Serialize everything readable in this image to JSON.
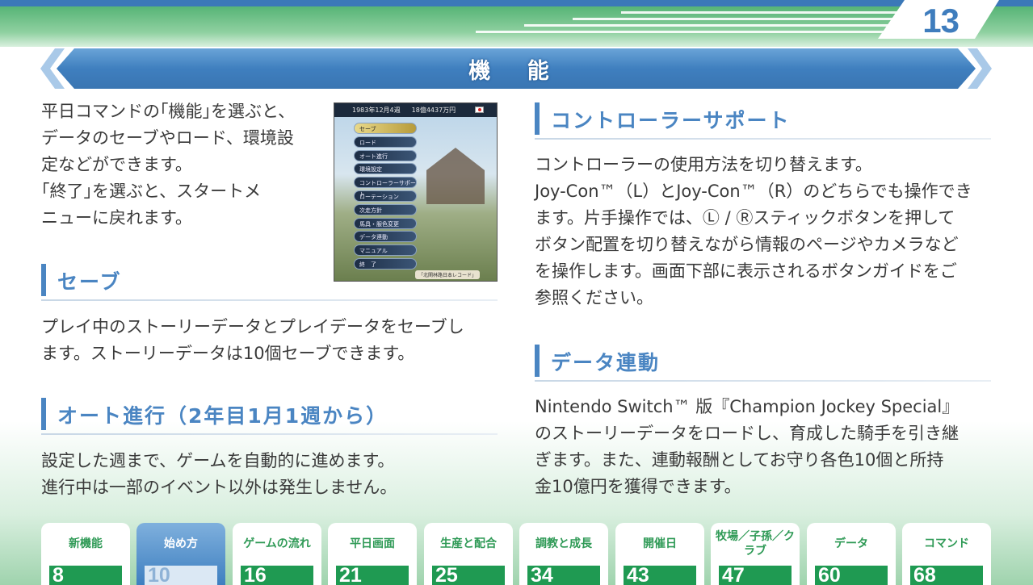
{
  "page_number": "13",
  "title": "機 能",
  "intro": {
    "lines": [
      "平日コマンドの｢機能｣を選ぶと、",
      "データのセーブやロード、環境設",
      "定などができます。",
      "｢終了｣を選ぶと、スタートメ",
      "ニューに戻れます。"
    ]
  },
  "screenshot": {
    "date": "1983年12月4週",
    "money": "18億4437万円",
    "menu": [
      "セーブ",
      "ロード",
      "オート進行",
      "環境設定",
      "コントローラーサポート",
      "ローテーション",
      "次走方針",
      "馬具・服色変更",
      "データ連動",
      "マニュアル",
      "終　了"
    ],
    "caption": "「北関林路日本レコード」"
  },
  "sections": {
    "save": {
      "heading": "セーブ",
      "lines": [
        "プレイ中のストーリーデータとプレイデータをセーブし",
        "ます。ストーリーデータは10個セーブできます。"
      ]
    },
    "auto": {
      "heading": "オート進行（2年目1月1週から）",
      "lines": [
        "設定した週まで、ゲームを自動的に進めます。",
        "進行中は一部のイベント以外は発生しません。"
      ]
    },
    "controller": {
      "heading": "コントローラーサポート",
      "lines": [
        "コントローラーの使用方法を切り替えます。",
        "Joy-Con™（L）とJoy-Con™（R）のどちらでも操作でき",
        "ます。片手操作では、Ⓛ / Ⓡスティックボタンを押して",
        "ボタン配置を切り替えながら情報のページやカメラなど",
        "を操作します。画面下部に表示されるボタンガイドをご",
        "参照ください。"
      ]
    },
    "data_link": {
      "heading": "データ連動",
      "lines": [
        "Nintendo Switch™ 版『Champion Jockey Special』",
        "のストーリーデータをロードし、育成した騎手を引き継",
        "ぎます。また、連動報酬としてお守り各色10個と所持",
        "金10億円を獲得できます。"
      ]
    }
  },
  "tabs": [
    {
      "label": "新機能",
      "page": "8"
    },
    {
      "label": "始め方",
      "page": "10"
    },
    {
      "label": "ゲームの流れ",
      "page": "16"
    },
    {
      "label": "平日画面",
      "page": "21"
    },
    {
      "label": "生産と配合",
      "page": "25"
    },
    {
      "label": "調教と成長",
      "page": "34"
    },
    {
      "label": "開催日",
      "page": "43"
    },
    {
      "label": "牧場／子孫／クラブ",
      "page": "47"
    },
    {
      "label": "データ",
      "page": "60"
    },
    {
      "label": "コマンド",
      "page": "68"
    }
  ],
  "colors": {
    "accent_blue": "#4a85c2",
    "tab_green": "#1f9a52"
  }
}
